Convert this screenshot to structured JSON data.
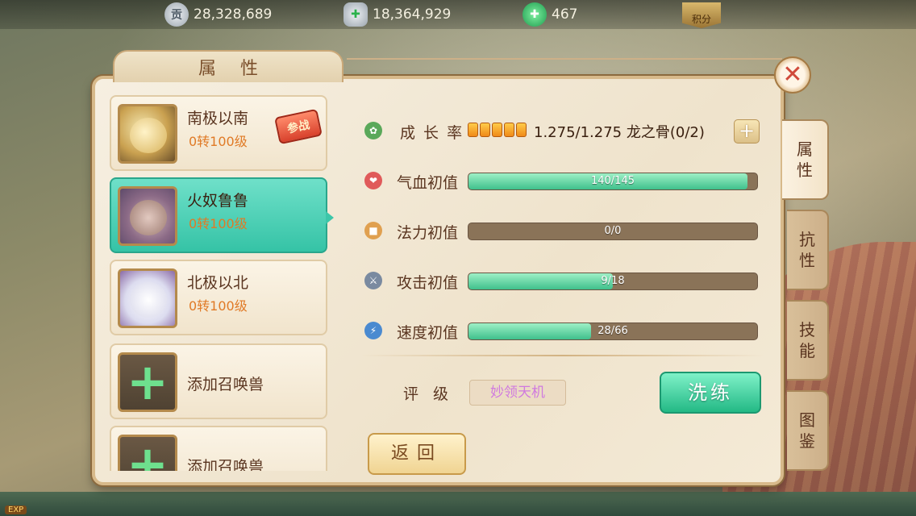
{
  "currencies": [
    {
      "icon": "silver-coin-icon",
      "icon_char": "贡",
      "value": "28,328,689"
    },
    {
      "icon": "silver-ingot-add-icon",
      "icon_char": "✚",
      "value": "18,364,929"
    },
    {
      "icon": "jade-gem-add-icon",
      "icon_char": "✚",
      "value": "467"
    }
  ],
  "points_badge": "积分",
  "panel": {
    "title": "属性",
    "close": "✕"
  },
  "pets": [
    {
      "name": "南极以南",
      "level": "0转100级",
      "stamp": "参战"
    },
    {
      "name": "火奴鲁鲁",
      "level": "0转100级"
    },
    {
      "name": "北极以北",
      "level": "0转100级"
    },
    {
      "name": "添加召唤兽"
    },
    {
      "name": "添加召唤兽"
    }
  ],
  "add_icon": "+",
  "growth": {
    "label": "成 长 率",
    "stars": 5,
    "value": "1.275/1.275  龙之骨(0/2)",
    "plus": "+"
  },
  "stats": [
    {
      "label": "气血初值",
      "text": "140/145",
      "fraction": 0.966,
      "icon_char": "❤",
      "color": "#e05a5a"
    },
    {
      "label": "法力初值",
      "text": "0/0",
      "fraction": 0,
      "icon_char": "■",
      "color": "#e0a050"
    },
    {
      "label": "攻击初值",
      "text": "9/18",
      "fraction": 0.5,
      "icon_char": "⚔",
      "color": "#7a8aa0"
    },
    {
      "label": "速度初值",
      "text": "28/66",
      "fraction": 0.424,
      "icon_char": "⚡",
      "color": "#4a8ad0"
    }
  ],
  "rating": {
    "label": "评级",
    "value": "妙领天机"
  },
  "buttons": {
    "wash": "洗练",
    "back": "返回"
  },
  "side_tabs": [
    "属性",
    "抗性",
    "技能",
    "图鉴"
  ],
  "exp_badge": "EXP"
}
